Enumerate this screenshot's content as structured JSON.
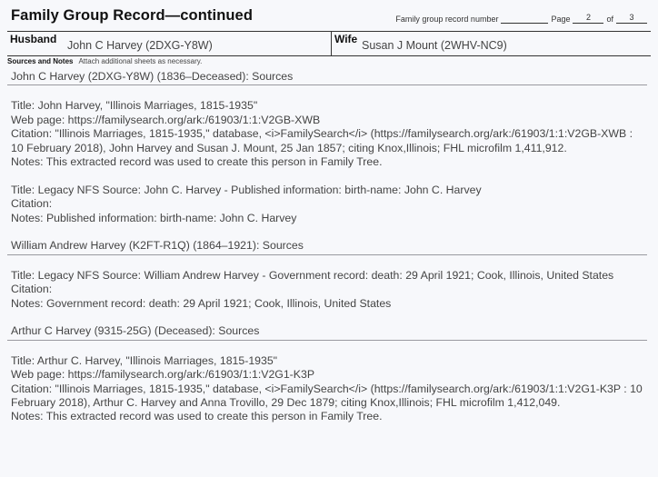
{
  "header": {
    "title": "Family Group Record—continued",
    "record_number_label": "Family group record number",
    "record_number_value": "",
    "page_label": "Page",
    "page_value": "2",
    "of_label": "of",
    "of_value": "3"
  },
  "husband": {
    "label": "Husband",
    "value": "John C Harvey (2DXG-Y8W)"
  },
  "wife": {
    "label": "Wife",
    "value": "Susan J Mount (2WHV-NC9)"
  },
  "sources_notes": {
    "label": "Sources and Notes",
    "sub": "Attach additional sheets as necessary."
  },
  "sections": [
    {
      "heading": "John C Harvey (2DXG-Y8W) (1836–Deceased): Sources",
      "sources": [
        {
          "title": "Title: John Harvey, \"Illinois Marriages, 1815-1935\"",
          "web": "Web page: https://familysearch.org/ark:/61903/1:1:V2GB-XWB",
          "citation": "Citation: \"Illinois Marriages, 1815-1935,\" database, <i>FamilySearch</i> (https://familysearch.org/ark:/61903/1:1:V2GB-XWB : 10 February 2018), John Harvey and Susan J. Mount, 25 Jan 1857; citing Knox,Illinois; FHL microfilm 1,411,912.",
          "notes": "Notes: This extracted record was used to create this person in Family Tree."
        },
        {
          "title": "Title: Legacy NFS Source: John C. Harvey - Published information: birth-name: John C. Harvey",
          "citation": "Citation:",
          "notes": "Notes: Published information: birth-name: John C. Harvey"
        }
      ]
    },
    {
      "heading": "William Andrew Harvey (K2FT-R1Q) (1864–1921): Sources",
      "sources": [
        {
          "title": "Title: Legacy NFS Source: William Andrew Harvey - Government record: death: 29 April 1921; Cook, Illinois, United States",
          "citation": "Citation:",
          "notes": "Notes: Government record: death: 29 April 1921; Cook, Illinois, United States"
        }
      ]
    },
    {
      "heading": "Arthur C Harvey (9315-25G) (Deceased): Sources",
      "sources": [
        {
          "title": "Title: Arthur C. Harvey, \"Illinois Marriages, 1815-1935\"",
          "web": "Web page: https://familysearch.org/ark:/61903/1:1:V2G1-K3P",
          "citation": "Citation: \"Illinois Marriages, 1815-1935,\" database, <i>FamilySearch</i> (https://familysearch.org/ark:/61903/1:1:V2G1-K3P : 10 February 2018), Arthur C. Harvey and Anna Trovillo, 29 Dec 1879; citing Knox,Illinois; FHL microfilm 1,412,049.",
          "notes": "Notes: This extracted record was used to create this person in Family Tree."
        }
      ]
    }
  ]
}
